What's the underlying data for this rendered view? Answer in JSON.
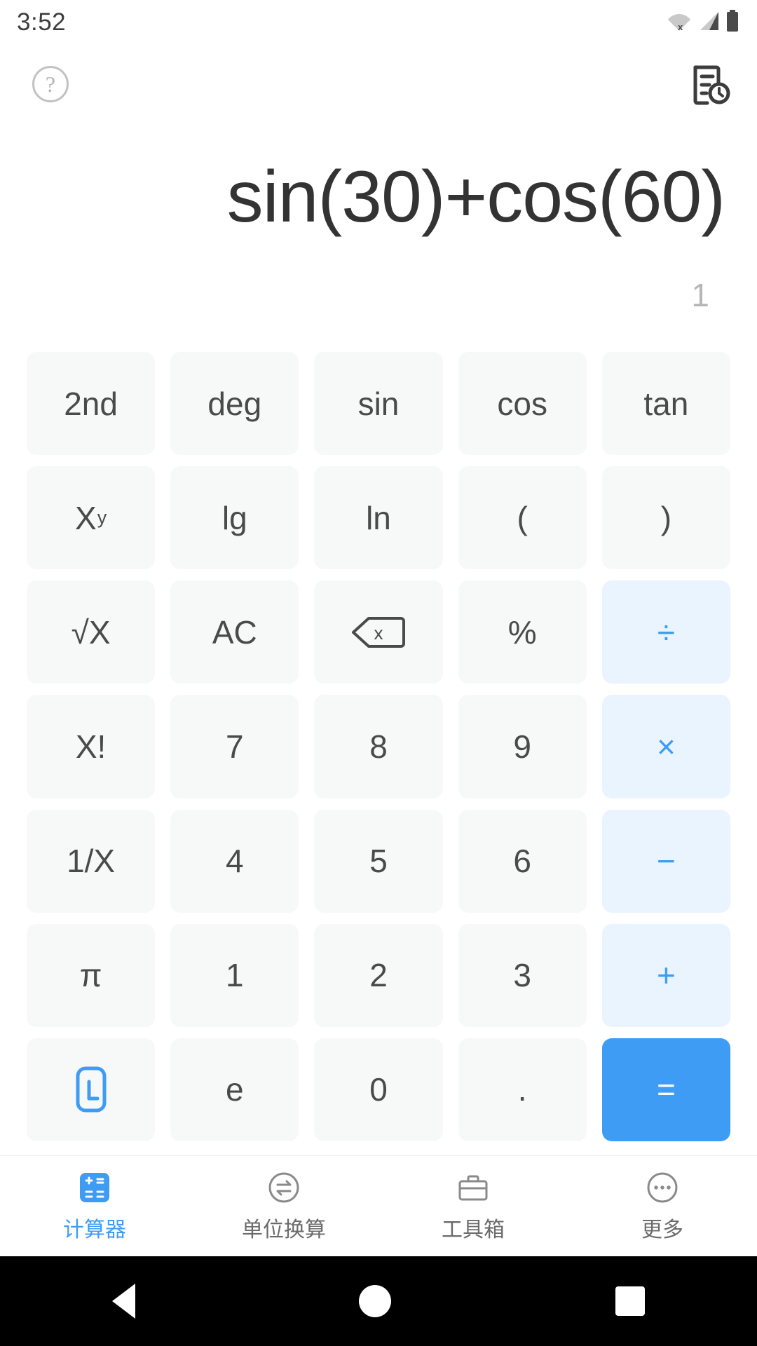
{
  "status_bar": {
    "time": "3:52",
    "icons": [
      "wifi-off-icon",
      "cellular-signal-icon",
      "battery-full-icon"
    ]
  },
  "app_bar": {
    "help_label": "?",
    "help_icon": "help-circle-icon",
    "history_icon": "history-list-icon"
  },
  "display": {
    "expression": "sin(30)+cos(60)",
    "result": "1"
  },
  "keypad": {
    "rows": [
      [
        {
          "label": "2nd",
          "type": "func",
          "name": "key-second"
        },
        {
          "label": "deg",
          "type": "func",
          "name": "key-deg"
        },
        {
          "label": "sin",
          "type": "func",
          "name": "key-sin"
        },
        {
          "label": "cos",
          "type": "func",
          "name": "key-cos"
        },
        {
          "label": "tan",
          "type": "func",
          "name": "key-tan"
        }
      ],
      [
        {
          "label": "X",
          "sup": "y",
          "type": "func",
          "name": "key-power"
        },
        {
          "label": "lg",
          "type": "func",
          "name": "key-lg"
        },
        {
          "label": "ln",
          "type": "func",
          "name": "key-ln"
        },
        {
          "label": "(",
          "type": "func",
          "name": "key-open-paren"
        },
        {
          "label": ")",
          "type": "func",
          "name": "key-close-paren"
        }
      ],
      [
        {
          "label": "√X",
          "type": "func",
          "name": "key-sqrt"
        },
        {
          "label": "AC",
          "type": "func",
          "name": "key-all-clear"
        },
        {
          "label": "",
          "type": "icon",
          "icon": "backspace-icon",
          "name": "key-backspace"
        },
        {
          "label": "%",
          "type": "func",
          "name": "key-percent"
        },
        {
          "label": "÷",
          "type": "op",
          "name": "key-divide"
        }
      ],
      [
        {
          "label": "X!",
          "type": "func",
          "name": "key-factorial"
        },
        {
          "label": "7",
          "type": "num",
          "name": "key-7"
        },
        {
          "label": "8",
          "type": "num",
          "name": "key-8"
        },
        {
          "label": "9",
          "type": "num",
          "name": "key-9"
        },
        {
          "label": "×",
          "type": "op",
          "name": "key-multiply"
        }
      ],
      [
        {
          "label": "1/X",
          "type": "func",
          "name": "key-reciprocal"
        },
        {
          "label": "4",
          "type": "num",
          "name": "key-4"
        },
        {
          "label": "5",
          "type": "num",
          "name": "key-5"
        },
        {
          "label": "6",
          "type": "num",
          "name": "key-6"
        },
        {
          "label": "−",
          "type": "op",
          "name": "key-minus"
        }
      ],
      [
        {
          "label": "π",
          "type": "func",
          "name": "key-pi"
        },
        {
          "label": "1",
          "type": "num",
          "name": "key-1"
        },
        {
          "label": "2",
          "type": "num",
          "name": "key-2"
        },
        {
          "label": "3",
          "type": "num",
          "name": "key-3"
        },
        {
          "label": "+",
          "type": "op",
          "name": "key-plus"
        }
      ],
      [
        {
          "label": "",
          "type": "icon",
          "icon": "collapse-keypad-icon",
          "name": "key-collapse"
        },
        {
          "label": "e",
          "type": "num",
          "name": "key-e"
        },
        {
          "label": "0",
          "type": "num",
          "name": "key-0"
        },
        {
          "label": ".",
          "type": "num",
          "name": "key-decimal"
        },
        {
          "label": "=",
          "type": "equals",
          "name": "key-equals"
        }
      ]
    ]
  },
  "bottom_nav": {
    "items": [
      {
        "label": "计算器",
        "icon": "calculator-icon",
        "active": true,
        "name": "nav-calculator"
      },
      {
        "label": "单位换算",
        "icon": "unit-convert-icon",
        "active": false,
        "name": "nav-unit-convert"
      },
      {
        "label": "工具箱",
        "icon": "toolbox-icon",
        "active": false,
        "name": "nav-toolbox"
      },
      {
        "label": "更多",
        "icon": "more-dots-icon",
        "active": false,
        "name": "nav-more"
      }
    ]
  },
  "system_nav": {
    "back": "back-triangle-icon",
    "home": "home-circle-icon",
    "recents": "recents-square-icon"
  },
  "colors": {
    "accent": "#3f9cf5",
    "op_bg": "#eaf4fe",
    "key_bg": "#f7f8f8",
    "text": "#4a4a4a",
    "expr_text": "#333333",
    "result_text": "#b6b6b6"
  }
}
